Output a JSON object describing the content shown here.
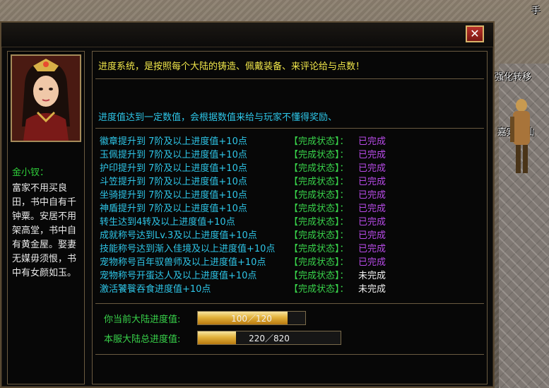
{
  "world": {
    "npc_label_top": "手",
    "npc_label_mid": "强化转移",
    "npc_label_low": "嘉宾老仙"
  },
  "window": {
    "close_icon": "close-icon",
    "close_glyph": "✕"
  },
  "npc": {
    "name": "金小钗：",
    "description": "富家不用买良田，书中自有千钟粟。安居不用架高堂，书中自有黄金屋。娶妻无媒毋须恨，书中有女颜如玉。"
  },
  "intro": "进度系统，是按照每个大陆的铸造、佩戴装备、来评论给与点数！",
  "subtitle": "进度值达到一定数值，会根据数值来给与玩家不懂得奖励、",
  "status_label": "【完成状态】：",
  "tasks": [
    {
      "name": "徽章提升到 7阶及以上进度值+10点",
      "status": "已完成",
      "done": true
    },
    {
      "name": "玉佩提升到 7阶及以上进度值+10点",
      "status": "已完成",
      "done": true
    },
    {
      "name": "护印提升到 7阶及以上进度值+10点",
      "status": "已完成",
      "done": true
    },
    {
      "name": "斗笠提升到 7阶及以上进度值+10点",
      "status": "已完成",
      "done": true
    },
    {
      "name": "坐骑提升到 7阶及以上进度值+10点",
      "status": "已完成",
      "done": true
    },
    {
      "name": "神盾提升到 7阶及以上进度值+10点",
      "status": "已完成",
      "done": true
    },
    {
      "name": "转生达到4转及以上进度值+10点",
      "status": "已完成",
      "done": true
    },
    {
      "name": "成就称号达到Lv.3及以上进度值+10点",
      "status": "已完成",
      "done": true
    },
    {
      "name": "技能称号达到渐入佳境及以上进度值+10点",
      "status": "已完成",
      "done": true
    },
    {
      "name": "宠物称号百年驭兽师及以上进度值+10点",
      "status": "已完成",
      "done": true
    },
    {
      "name": "宠物称号开蛋达人及以上进度值+10点",
      "status": "未完成",
      "done": false
    },
    {
      "name": "激活饕餮吞食进度值+10点",
      "status": "未完成",
      "done": false
    }
  ],
  "progress": {
    "current_label": "你当前大陆进度值:",
    "current_text": "100／120",
    "current_fraction": 0.833,
    "total_label": "本服大陆总进度值:",
    "total_text": "220／820",
    "total_fraction": 0.268
  },
  "colors": {
    "task_name": "#2ec6e8",
    "status_label": "#38d24a",
    "done": "#b84be8",
    "undone": "#f0f0f0",
    "intro": "#f0e64a"
  }
}
